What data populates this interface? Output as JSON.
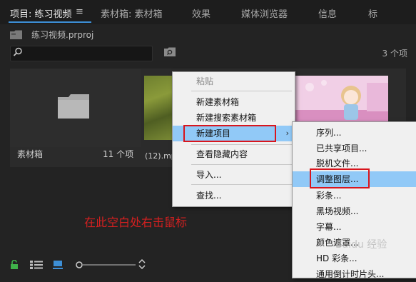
{
  "tabs": [
    {
      "label": "项目: 练习视频",
      "active": true
    },
    {
      "label": "素材箱: 素材箱",
      "active": false
    },
    {
      "label": "效果",
      "active": false
    },
    {
      "label": "媒体浏览器",
      "active": false
    },
    {
      "label": "信息",
      "active": false
    },
    {
      "label": "标",
      "active": false
    }
  ],
  "tab_menu_icon": "hamburger-icon",
  "project": {
    "file": "练习视频.prproj"
  },
  "search": {
    "placeholder": ""
  },
  "item_count": "3 个项",
  "bin": {
    "label": "素材箱",
    "count": "11 个项"
  },
  "clip": {
    "label": "(12).mp"
  },
  "hint": "在此空白处右击鼠标",
  "context_menu": {
    "items": [
      "粘贴",
      "新建素材箱",
      "新建搜索素材箱",
      "新建项目",
      "查看隐藏内容",
      "导入...",
      "查找..."
    ],
    "disabled": [
      "粘贴"
    ],
    "highlighted": "新建项目"
  },
  "submenu": {
    "items": [
      "序列...",
      "已共享项目...",
      "脱机文件...",
      "调整图层...",
      "彩条...",
      "黑场视频...",
      "字幕...",
      "颜色遮罩...",
      "HD 彩条...",
      "通用倒计时片头..."
    ],
    "highlighted": "调整图层..."
  },
  "watermark": "Baidu 经验",
  "colors": {
    "accent": "#3d8fd6",
    "menu_highlight": "#91c9f7",
    "annotation_red": "#d8151d",
    "lock_green": "#3fb24a"
  }
}
